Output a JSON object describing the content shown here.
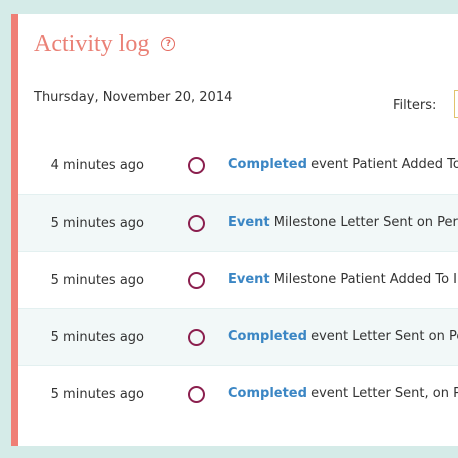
{
  "panel": {
    "title": "Activity log",
    "help_icon": "?",
    "date": "Thursday, November 20, 2014",
    "filters_label": "Filters:"
  },
  "entries": [
    {
      "time": "4 minutes ago",
      "tag": "Completed",
      "message": "event Patient Added To In"
    },
    {
      "time": "5 minutes ago",
      "tag": "Event",
      "message": "Milestone Letter Sent on Period"
    },
    {
      "time": "5 minutes ago",
      "tag": "Event",
      "message": "Milestone Patient Added To Inp"
    },
    {
      "time": "5 minutes ago",
      "tag": "Completed",
      "message": "event Letter Sent on Perio"
    },
    {
      "time": "5 minutes ago",
      "tag": "Completed",
      "message": "event Letter Sent, on Perio"
    }
  ],
  "colors": {
    "accent": "#ef7f76",
    "link": "#3b86c4",
    "dot": "#8b1f4e"
  }
}
